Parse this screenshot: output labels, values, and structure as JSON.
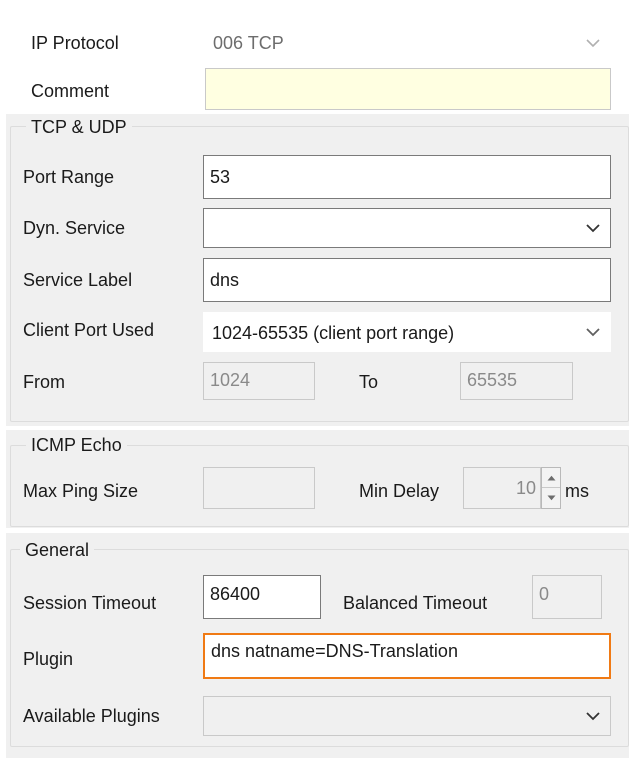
{
  "top": {
    "ip_protocol": {
      "label": "IP Protocol",
      "value": "006 TCP"
    },
    "comment": {
      "label": "Comment",
      "value": ""
    }
  },
  "tcp_udp": {
    "title": "TCP & UDP",
    "port_range": {
      "label": "Port Range",
      "value": "53"
    },
    "dyn_service": {
      "label": "Dyn. Service",
      "value": ""
    },
    "service_label": {
      "label": "Service Label",
      "value": "dns"
    },
    "client_port_used": {
      "label": "Client Port Used",
      "value": "1024-65535 (client port range)"
    },
    "from": {
      "label": "From",
      "value": "1024"
    },
    "to": {
      "label": "To",
      "value": "65535"
    }
  },
  "icmp_echo": {
    "title": "ICMP Echo",
    "max_ping_size": {
      "label": "Max Ping Size",
      "value": ""
    },
    "min_delay": {
      "label": "Min Delay",
      "value": "10",
      "unit": "ms"
    }
  },
  "general": {
    "title": "General",
    "session_timeout": {
      "label": "Session Timeout",
      "value": "86400"
    },
    "balanced_timeout": {
      "label": "Balanced Timeout",
      "value": "0"
    },
    "plugin": {
      "label": "Plugin",
      "value": "dns natname=DNS-Translation"
    },
    "available_plugins": {
      "label": "Available Plugins",
      "value": ""
    }
  },
  "colors": {
    "panel": "#f0f0f0",
    "focus_border": "#f07a14",
    "comment_bg": "#ffffe1"
  },
  "icons": {
    "dropdown": "chevron-down-icon",
    "spin_up": "triangle-up-icon",
    "spin_down": "triangle-down-icon"
  }
}
